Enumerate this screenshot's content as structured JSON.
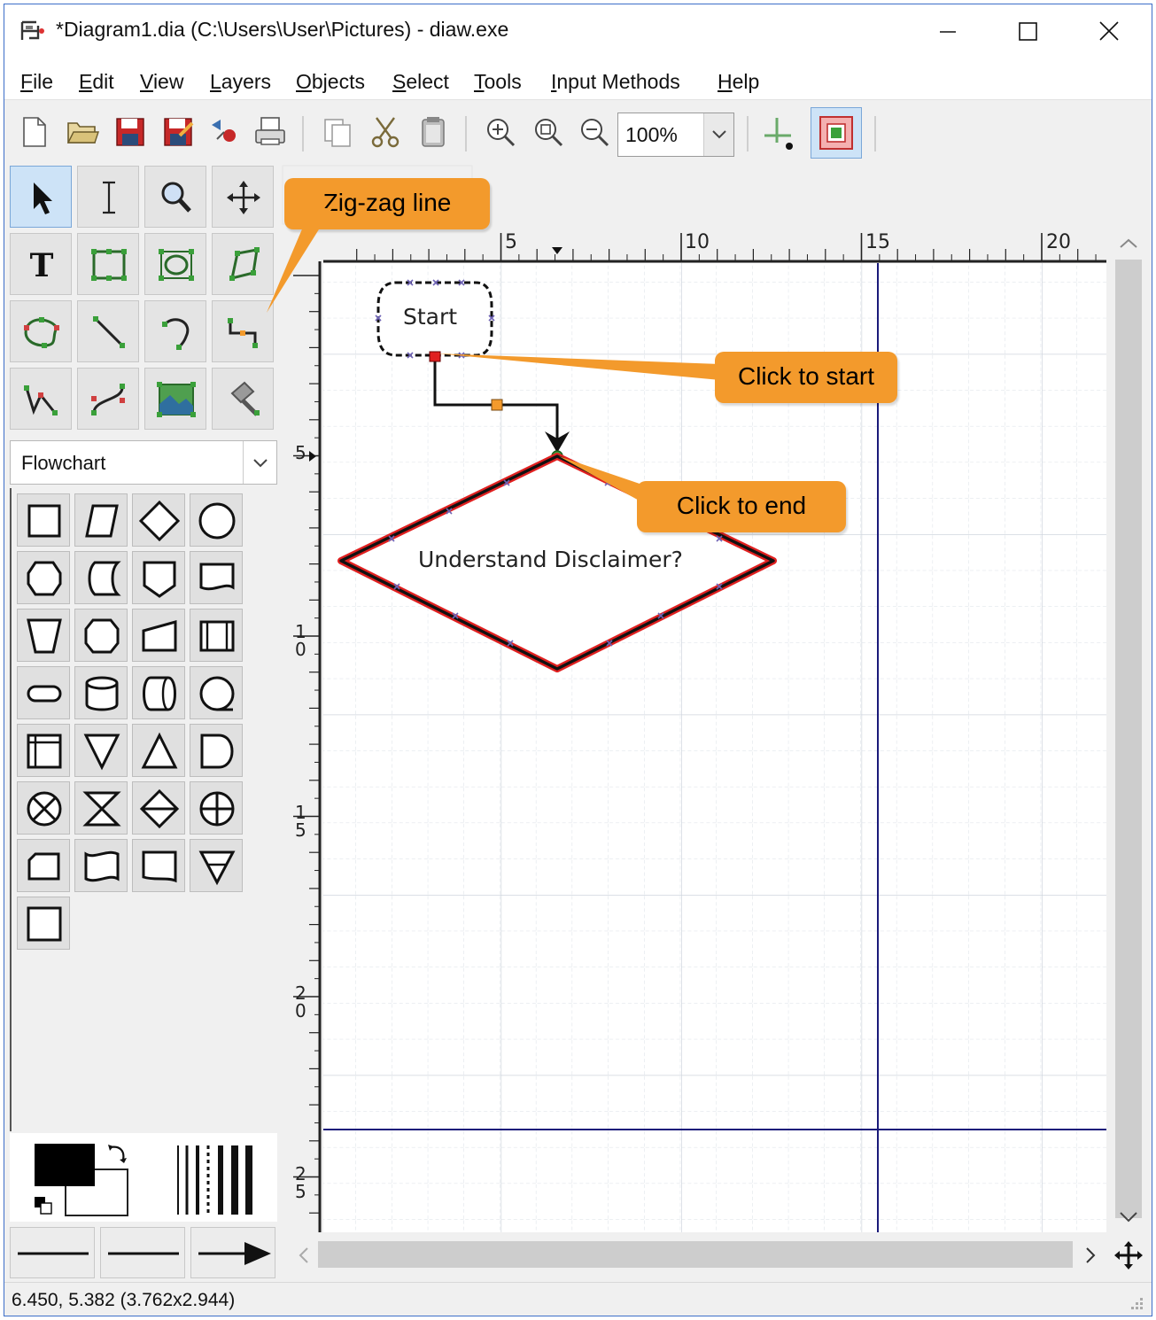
{
  "window": {
    "title": "*Diagram1.dia (C:\\Users\\User\\Pictures) - diaw.exe"
  },
  "menu": [
    "File",
    "Edit",
    "View",
    "Layers",
    "Objects",
    "Select",
    "Tools",
    "Input Methods",
    "Help"
  ],
  "toolbar": {
    "zoom_value": "100%",
    "buttons": [
      "new-file-icon",
      "open-folder-icon",
      "save-icon",
      "save-as-icon",
      "export-icon",
      "print-icon",
      "copy-icon",
      "cut-icon",
      "paste-icon",
      "zoom-in-icon",
      "zoom-fit-icon",
      "zoom-out-icon",
      "snap-to-grid-icon",
      "snap-to-objects-icon"
    ]
  },
  "toolbox": {
    "tools": [
      "pointer-tool",
      "text-edit-tool",
      "magnify-tool",
      "scroll-tool",
      "text-tool",
      "box-tool",
      "ellipse-tool",
      "polygon-tool",
      "beziergon-tool",
      "line-tool",
      "arc-tool",
      "zigzag-line-tool",
      "polyline-tool",
      "bezier-line-tool",
      "image-tool",
      "outline-tool"
    ]
  },
  "sheet": {
    "selected": "Flowchart"
  },
  "rulers": {
    "top_labels": [
      "5",
      "10",
      "15",
      "20"
    ],
    "left_labels": [
      "5",
      "1\n0",
      "1\n5",
      "2\n0",
      "2\n5"
    ]
  },
  "diagram": {
    "start_label": "Start",
    "decision_label": "Understand Disclaimer?"
  },
  "callouts": {
    "zigzag": "Zig-zag line",
    "click_start": "Click to start",
    "click_end": "Click to end"
  },
  "status": {
    "text": "6.450, 5.382 (3.762x2.944)"
  },
  "colors": {
    "callout": "#f39a2c",
    "selection": "#e02020",
    "guide": "#1a1a7a",
    "grid": "#d7dde4"
  }
}
